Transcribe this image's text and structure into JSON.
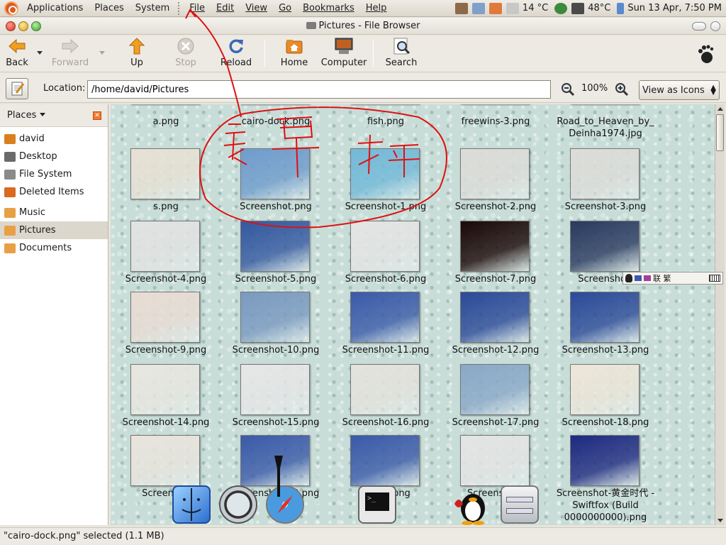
{
  "top_panel": {
    "menus": [
      "Applications",
      "Places",
      "System"
    ],
    "file_menu": [
      "File",
      "Edit",
      "View",
      "Go",
      "Bookmarks",
      "Help"
    ],
    "weather": "14 °C",
    "cpu_temp": "48°C",
    "datetime": "Sun 13 Apr,  7:50 PM"
  },
  "window": {
    "title": "Pictures - File Browser"
  },
  "toolbar": {
    "back": "Back",
    "forward": "Forward",
    "up": "Up",
    "stop": "Stop",
    "reload": "Reload",
    "home": "Home",
    "computer": "Computer",
    "search": "Search"
  },
  "location": {
    "label": "Location:",
    "path": "/home/david/Pictures",
    "zoom": "100%",
    "view_mode": "View as Icons"
  },
  "sidebar": {
    "title": "Places",
    "items": [
      {
        "label": "david",
        "icon": "home-folder-icon",
        "color": "#d9801e"
      },
      {
        "label": "Desktop",
        "icon": "desktop-icon",
        "color": "#6a6a6a"
      },
      {
        "label": "File System",
        "icon": "drive-icon",
        "color": "#8a8a8a"
      },
      {
        "label": "Deleted Items",
        "icon": "trash-icon",
        "color": "#d96a1e"
      },
      {
        "label": "Music",
        "icon": "folder-icon",
        "color": "#e8a046"
      },
      {
        "label": "Pictures",
        "icon": "folder-icon",
        "color": "#e8a046"
      },
      {
        "label": "Documents",
        "icon": "folder-icon",
        "color": "#e8a046"
      }
    ],
    "selected": "Pictures"
  },
  "files": [
    "a.png",
    "cairo-dock.png",
    "fish.png",
    "freewins-3.png",
    "Road_to_Heaven_by_\nDeinha1974.jpg",
    "s.png",
    "Screenshot.png",
    "Screenshot-1.png",
    "Screenshot-2.png",
    "Screenshot-3.png",
    "Screenshot-4.png",
    "Screenshot-5.png",
    "Screenshot-6.png",
    "Screenshot-7.png",
    "Screenshot-",
    "Screenshot-9.png",
    "Screenshot-10.png",
    "Screenshot-11.png",
    "Screenshot-12.png",
    "Screenshot-13.png",
    "Screenshot-14.png",
    "Screenshot-15.png",
    "Screenshot-16.png",
    "Screenshot-17.png",
    "Screenshot-18.png",
    "Screensho",
    "Screenshot-20.png",
    "Sc          -21.png",
    "Screensho   g",
    "Screenshot-黄金时代 -\nSwiftfox (Build\n0000000000).png"
  ],
  "thumb_colors": [
    "#d8c7a0",
    "#c9d6b5",
    "#e8e2b0",
    "#303848",
    "#c0a060",
    "#e7e1d4",
    "#6f9ccc",
    "#72b9d8",
    "#dcdcd8",
    "#dcdcd8",
    "#e2e2e2",
    "#3458a0",
    "#e4e4e4",
    "#1a0808",
    "#2a3a60",
    "#e8dcd4",
    "#7a9ac0",
    "#3a5aa8",
    "#2b4a98",
    "#2b4a98",
    "#e8e6e0",
    "#e6e6e6",
    "#e4e2dc",
    "#8aa8c8",
    "#ece6d8",
    "#e8e4dc",
    "#3a5aa8",
    "#3a5aa8",
    "#e4e4e4",
    "#1e2a80"
  ],
  "status": "\"cairo-dock.png\" selected (1.1 MB)",
  "ime_bar": "联 繁"
}
